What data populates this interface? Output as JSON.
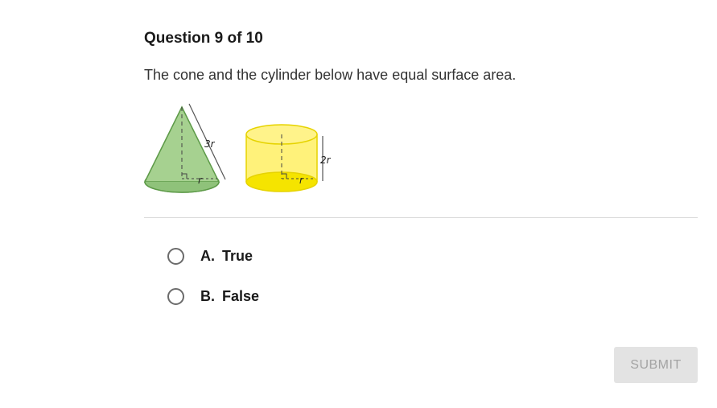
{
  "question": {
    "header": "Question 9 of 10",
    "prompt": "The cone and the cylinder below have equal surface area."
  },
  "figure": {
    "cone": {
      "slant_label": "3r",
      "radius_label": "r",
      "color": "#8fc27a"
    },
    "cylinder": {
      "height_label": "2r",
      "radius_label": "r",
      "color": "#fff27a"
    }
  },
  "choices": [
    {
      "letter": "A.",
      "text": "True"
    },
    {
      "letter": "B.",
      "text": "False"
    }
  ],
  "submit": {
    "label": "SUBMIT"
  }
}
